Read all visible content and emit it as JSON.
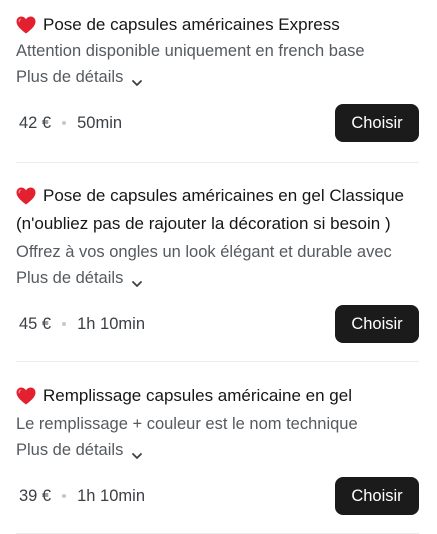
{
  "services": [
    {
      "title_lines": [
        "Pose de capsules américaines Express"
      ],
      "description": "Attention disponible uniquement en french base",
      "details_label": "Plus de détails",
      "price": "42 €",
      "duration": "50min",
      "choose_label": "Choisir"
    },
    {
      "title_lines": [
        "Pose de capsules américaines en gel Classique",
        "(n'oubliez pas de rajouter la décoration si besoin )"
      ],
      "description": "Offrez à vos ongles un look élégant et durable avec",
      "details_label": "Plus de détails",
      "price": "45 €",
      "duration": "1h 10min",
      "choose_label": "Choisir"
    },
    {
      "title_lines": [
        "Remplissage capsules américaine en gel"
      ],
      "description": "Le remplissage + couleur est le nom technique",
      "details_label": "Plus de détails",
      "price": "39 €",
      "duration": "1h 10min",
      "choose_label": "Choisir"
    }
  ],
  "icons": {
    "title_icon": "red-heart-icon",
    "details_icon": "chevron-down-icon"
  },
  "colors": {
    "heart": "#e3202f",
    "button_bg": "#1b1b1b",
    "button_text": "#ffffff",
    "muted_text": "#555a5f"
  }
}
